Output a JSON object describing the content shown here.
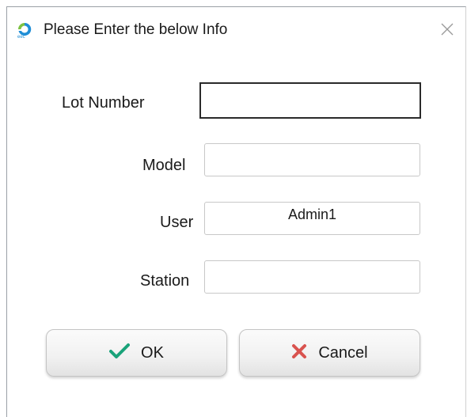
{
  "window": {
    "title": "Please Enter the below Info",
    "app_icon": "eec-logo-icon",
    "close_icon": "close-icon"
  },
  "form": {
    "lot_number": {
      "label": "Lot Number",
      "value": ""
    },
    "model": {
      "label": "Model",
      "value": ""
    },
    "user": {
      "label": "User",
      "value": "Admin1"
    },
    "station": {
      "label": "Station",
      "value": ""
    }
  },
  "buttons": {
    "ok": {
      "label": "OK",
      "icon": "checkmark-icon",
      "icon_color": "#1aa37a"
    },
    "cancel": {
      "label": "Cancel",
      "icon": "x-icon",
      "icon_color": "#d9534f"
    }
  }
}
